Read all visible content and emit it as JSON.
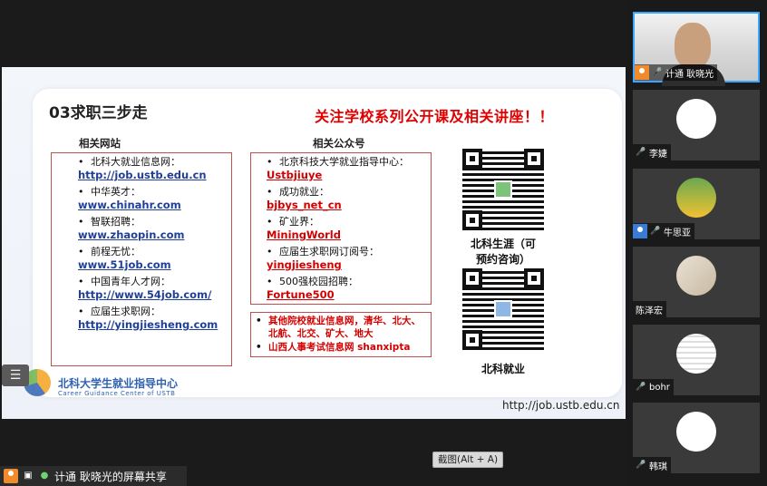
{
  "slide": {
    "title": "03求职三步走",
    "headline": "关注学校系列公开课及相关讲座！！",
    "websites_label": "相关网站",
    "wechat_label": "相关公众号",
    "websites": [
      {
        "name": "北科大就业信息网：",
        "link": "http://job.ustb.edu.cn"
      },
      {
        "name": "中华英才：",
        "link": "www.chinahr.com"
      },
      {
        "name": "智联招聘：",
        "link": "www.zhaopin.com"
      },
      {
        "name": "前程无忧：",
        "link": "www.51job.com"
      },
      {
        "name": "中国青年人才网：",
        "link": "http://www.54job.com/"
      },
      {
        "name": "应届生求职网：",
        "link": "http://yingjiesheng.com"
      }
    ],
    "accounts": [
      {
        "name": "北京科技大学就业指导中心：",
        "id": "Ustbjiuye"
      },
      {
        "name": "成功就业：",
        "id": "bjbys_net_cn"
      },
      {
        "name": "矿业界：",
        "id": "MiningWorld"
      },
      {
        "name": "应届生求职网订阅号：",
        "id": "yingjiesheng"
      },
      {
        "name": "500强校园招聘：",
        "id": "Fortune500"
      }
    ],
    "other_notes": [
      "其他院校就业信息网，清华、北大、",
      "北航、北交、矿大、地大",
      "山西人事考试信息网   shanxipta"
    ],
    "qr_caption_1_line1": "北科生涯（可",
    "qr_caption_1_line2": "预约咨询）",
    "qr_caption_2": "北科就业",
    "url": "http://job.ustb.edu.cn",
    "logo_cn": "北科大学生就业指导中心",
    "logo_en": "Career Guidance Center of USTB"
  },
  "toolbar": {
    "capture_label": "截图(Alt + A)"
  },
  "status": {
    "text": "计通 耿晓光的屏幕共享"
  },
  "participants": [
    {
      "name": "计通 耿晓光",
      "type": "video",
      "active": true,
      "muted": false,
      "host": true
    },
    {
      "name": "李婕",
      "type": "avatar",
      "muted": true,
      "host": false
    },
    {
      "name": "牛思亚",
      "type": "avatar",
      "muted": true,
      "host": true
    },
    {
      "name": "陈泽宏",
      "type": "avatar",
      "muted": false,
      "host": false
    },
    {
      "name": "bohr",
      "type": "avatar",
      "muted": true,
      "host": false
    },
    {
      "name": "韩琪",
      "type": "avatar",
      "muted": true,
      "host": false
    }
  ],
  "icons": {
    "menu": "list-icon",
    "mic": "microphone-icon",
    "screen": "screen-share-icon"
  },
  "colors": {
    "accent_red": "#e00000",
    "link_blue": "#1f3f9a",
    "active_border": "#3aa6ff",
    "host_orange": "#f08a2b"
  }
}
